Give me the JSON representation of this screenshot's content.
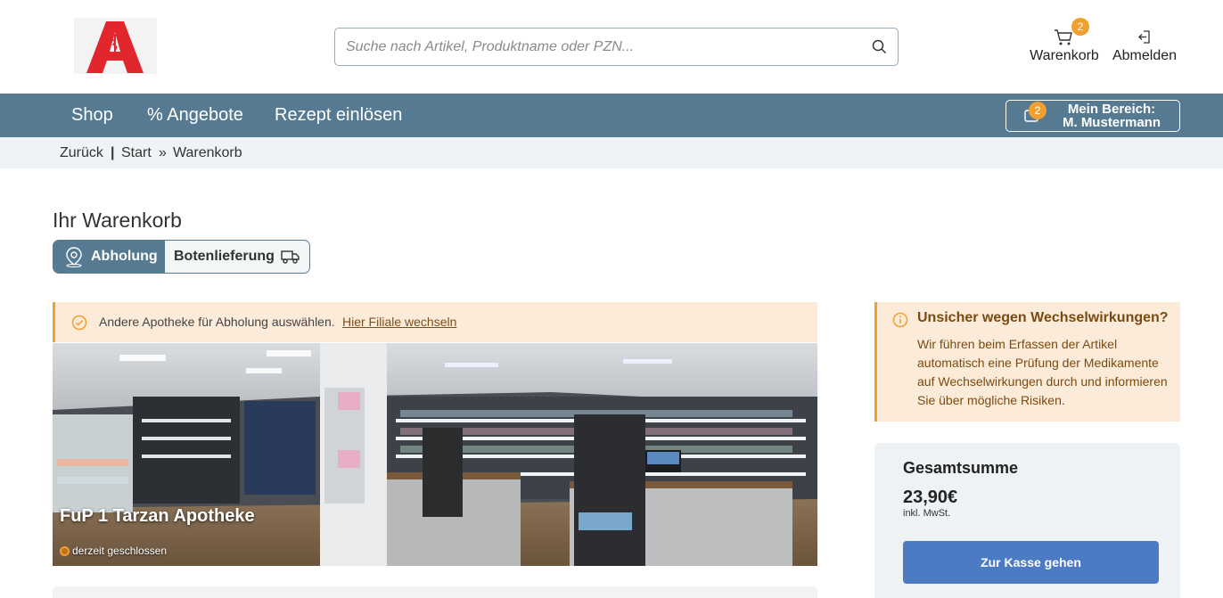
{
  "header": {
    "search_placeholder": "Suche nach Artikel, Produktname oder PZN...",
    "cart_label": "Warenkorb",
    "cart_count": "2",
    "logout_label": "Abmelden"
  },
  "nav": {
    "items": [
      {
        "label": "Shop"
      },
      {
        "label": "% Angebote"
      },
      {
        "label": "Rezept einlösen"
      }
    ],
    "account": {
      "line1": "Mein Bereich:",
      "line2": "M. Mustermann",
      "badge": "2"
    }
  },
  "breadcrumb": {
    "back": "Zurück",
    "sep": "|",
    "start": "Start",
    "arrow": "»",
    "current": "Warenkorb"
  },
  "page": {
    "title": "Ihr Warenkorb",
    "toggle": {
      "pickup": "Abholung",
      "delivery": "Botenlieferung",
      "active": "pickup"
    }
  },
  "pharmacy": {
    "info_text": "Andere Apotheke für Abholung auswählen.",
    "info_link": "Hier Filiale wechseln",
    "name": "FuP 1 Tarzan Apotheke",
    "status": "derzeit geschlossen"
  },
  "warning": {
    "title": "Unsicher wegen Wechselwirkungen?",
    "body": "Wir führen beim Erfassen der Artikel automatisch eine Prüfung der Medikamente auf Wechselwirkungen durch und informieren Sie über mögliche Risiken."
  },
  "summary": {
    "title": "Gesamtsumme",
    "price": "23,90€",
    "tax": "inkl. MwSt.",
    "checkout": "Zur Kasse gehen"
  },
  "colors": {
    "nav": "#557a91",
    "accent": "#f0a030",
    "info_bg": "#fcebd9",
    "checkout": "#4c7bc4"
  }
}
